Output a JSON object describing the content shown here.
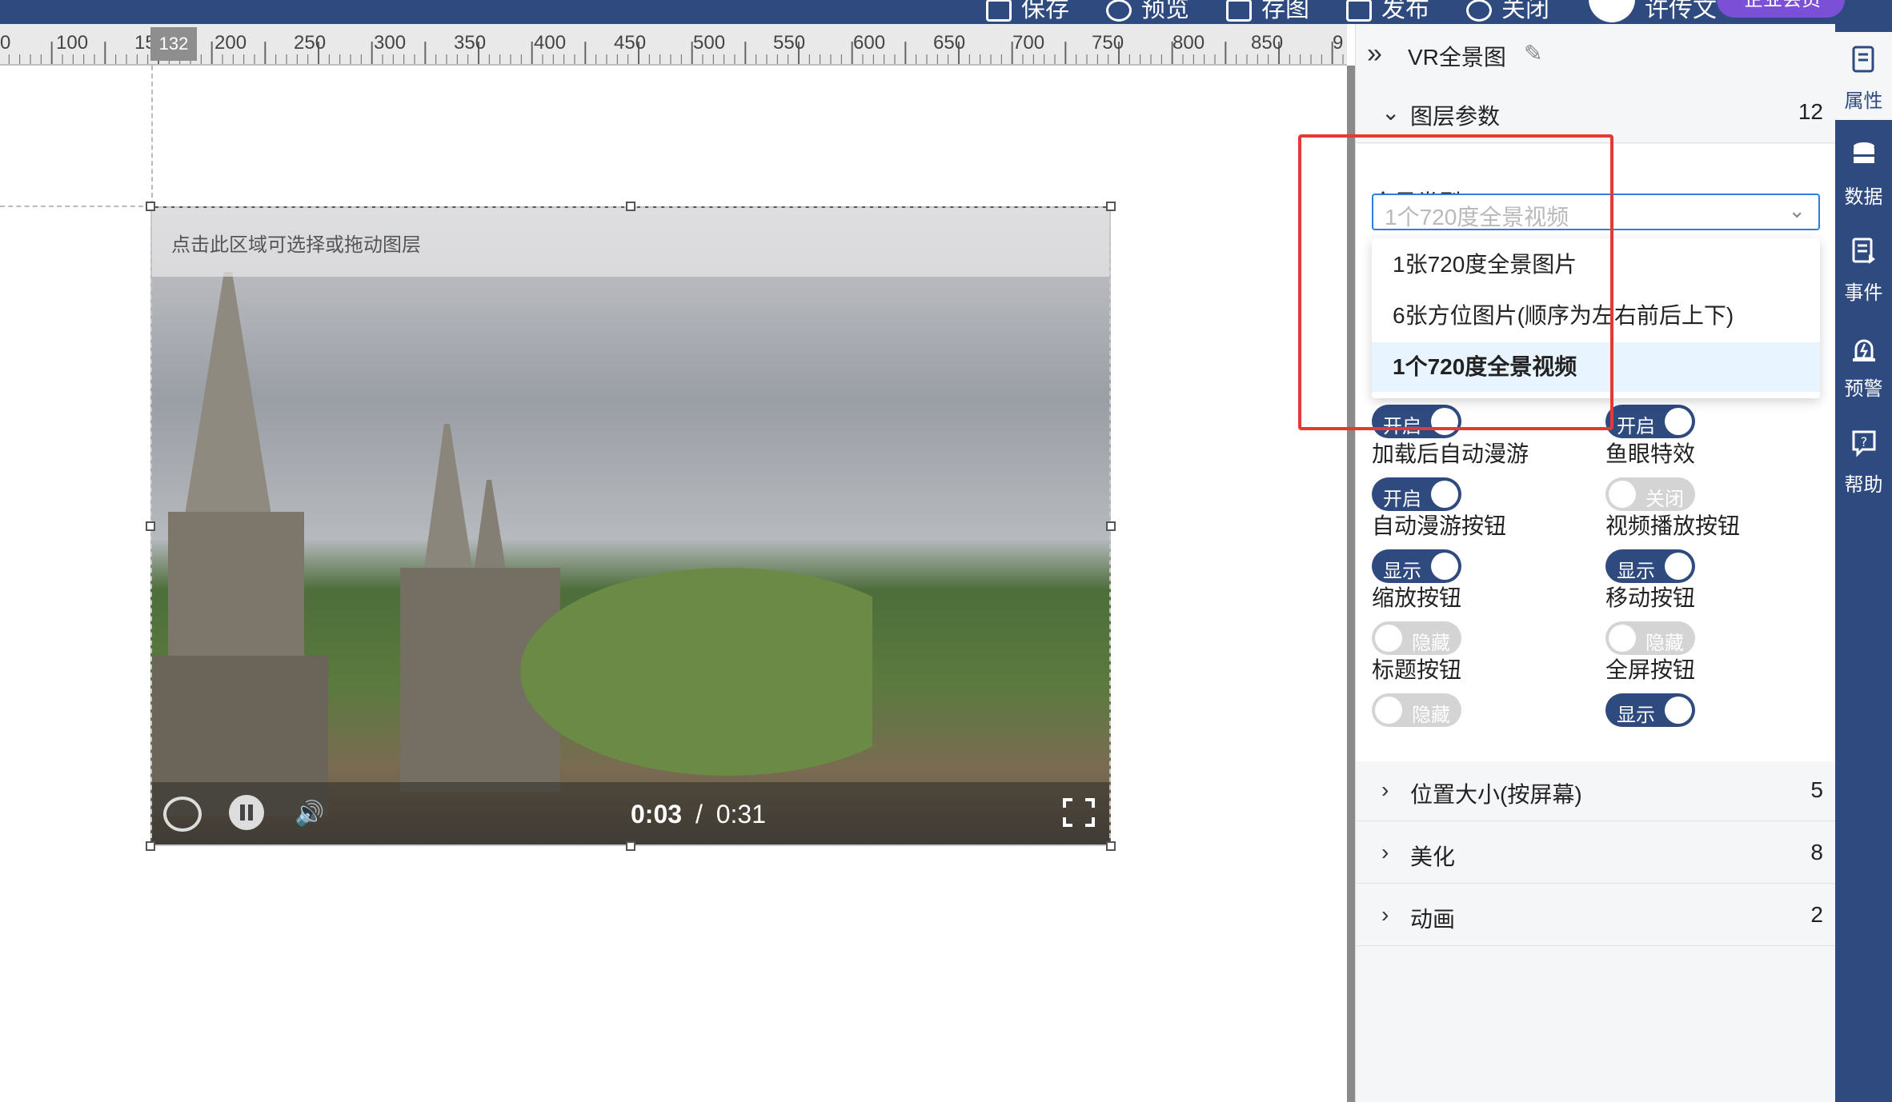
{
  "topbar": {
    "items": [
      {
        "label": "保存",
        "icon": "save-icon"
      },
      {
        "label": "预览",
        "icon": "preview-icon"
      },
      {
        "label": "存图",
        "icon": "export-image-icon"
      },
      {
        "label": "发布",
        "icon": "publish-icon"
      },
      {
        "label": "关闭",
        "icon": "close-icon"
      }
    ],
    "user_name": "许传文",
    "upgrade_label": "企业会员"
  },
  "ruler": {
    "labels": [
      "0",
      "100",
      "150",
      "200",
      "250",
      "300",
      "350",
      "400",
      "450",
      "500",
      "550",
      "600",
      "650",
      "700",
      "750",
      "800",
      "850",
      "9"
    ],
    "marker": "132"
  },
  "layer": {
    "hint": "点击此区域可选择或拖动图层",
    "time_current": "0:03",
    "time_separator": "/",
    "time_total": "0:31"
  },
  "panel": {
    "title": "VR全景图",
    "sections": [
      {
        "label": "图层参数",
        "count": "12",
        "expanded": true
      },
      {
        "label": "位置大小(按屏幕)",
        "count": "5",
        "expanded": false
      },
      {
        "label": "美化",
        "count": "8",
        "expanded": false
      },
      {
        "label": "动画",
        "count": "2",
        "expanded": false
      }
    ],
    "params": {
      "type_label": "全景类型",
      "type_value": "1个720度全景视频",
      "options": [
        "1张720度全景图片",
        "6张方位图片(顺序为左右前后上下)",
        "1个720度全景视频"
      ],
      "selected_option": "1个720度全景视频",
      "toggles": [
        {
          "label": "",
          "state": "开启",
          "on": true
        },
        {
          "label": "",
          "state": "开启",
          "on": true
        },
        {
          "label": "加载后自动漫游",
          "state": "开启",
          "on": true
        },
        {
          "label": "鱼眼特效",
          "state": "关闭",
          "on": false
        },
        {
          "label": "自动漫游按钮",
          "state": "显示",
          "on": true
        },
        {
          "label": "视频播放按钮",
          "state": "显示",
          "on": true
        },
        {
          "label": "缩放按钮",
          "state": "隐藏",
          "on": false
        },
        {
          "label": "移动按钮",
          "state": "隐藏",
          "on": false
        },
        {
          "label": "标题按钮",
          "state": "隐藏",
          "on": false
        },
        {
          "label": "全屏按钮",
          "state": "显示",
          "on": true
        }
      ]
    }
  },
  "sidebar": {
    "items": [
      {
        "label": "属性",
        "icon": "properties-icon",
        "active": true
      },
      {
        "label": "数据",
        "icon": "database-icon",
        "active": false
      },
      {
        "label": "事件",
        "icon": "event-icon",
        "active": false
      },
      {
        "label": "预警",
        "icon": "alarm-icon",
        "active": false
      },
      {
        "label": "帮助",
        "icon": "help-icon",
        "active": false
      }
    ]
  },
  "colors": {
    "brand": "#2e4a7f",
    "select_border": "#2e7de0",
    "highlight": "#e53935",
    "toggle_off": "#d4d4d4"
  }
}
